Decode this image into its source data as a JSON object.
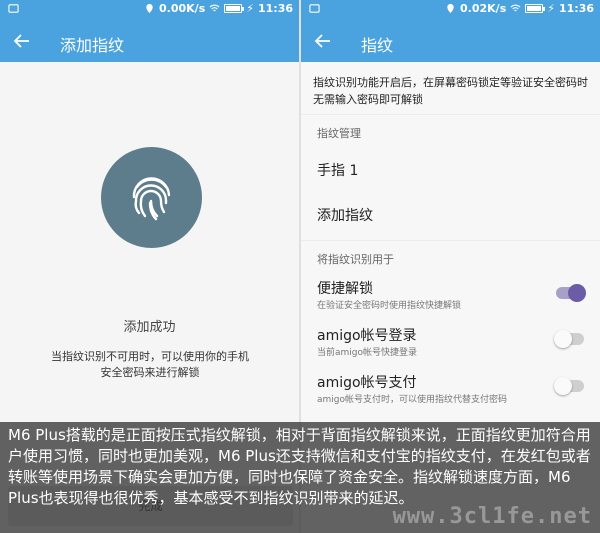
{
  "left": {
    "status": {
      "speed": "0.00K/s",
      "time": "11:36",
      "battery_level": 0.85
    },
    "title": "添加指纹",
    "success": "添加成功",
    "hint": "当指纹识别不可用时，可以使用你的手机安全密码来进行解锁",
    "done_label": "完成"
  },
  "right": {
    "status": {
      "speed": "0.02K/s",
      "time": "11:36",
      "battery_level": 0.85
    },
    "title": "指纹",
    "description": "指纹识别功能开启后，在屏幕密码锁定等验证安全密码时无需输入密码即可解锁",
    "manage_header": "指纹管理",
    "finger_item": "手指 1",
    "add_item": "添加指纹",
    "usage_header": "将指纹识别用于",
    "quick_unlock": {
      "title": "便捷解锁",
      "subtitle": "在验证安全密码时使用指纹快捷解锁",
      "enabled": true
    },
    "amigo_login": {
      "title": "amigo帐号登录",
      "subtitle": "当前amigo帐号快捷登录",
      "enabled": false
    },
    "amigo_pay": {
      "title": "amigo帐号支付",
      "subtitle": "amigo帐号支付时，可以使用指纹代替支付密码",
      "enabled": false
    }
  },
  "caption": "M6 Plus搭载的是正面按压式指纹解锁，相对于背面指纹解锁来说，正面指纹更加符合用户使用习惯，同时也更加美观，M6 Plus还支持微信和支付宝的指纹支付，在发红包或者转账等使用场景下确实会更加方便，同时也保障了资金安全。指纹解锁速度方面，M6 Plus也表现得也很优秀，基本感受不到指纹识别带来的延迟。",
  "watermark": "www.3cl1fe.net",
  "colors": {
    "accent": "#4aa3df",
    "toggle_on": "#6c5ba7",
    "fingerprint_bg": "#5e7d8c"
  },
  "icons": [
    "back-arrow-icon",
    "fingerprint-icon",
    "wifi-icon",
    "location-icon",
    "battery-icon",
    "charging-icon"
  ]
}
